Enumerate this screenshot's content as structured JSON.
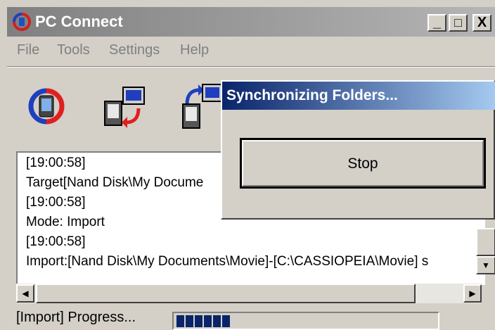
{
  "window": {
    "title": "PC Connect",
    "controls": {
      "minimize": "_",
      "maximize": "□",
      "close": "X"
    }
  },
  "menu": [
    "File",
    "Tools",
    "Settings",
    "Help"
  ],
  "toolbar": {
    "buttons": [
      {
        "name": "sync-icon"
      },
      {
        "name": "transfer-to-pc-icon"
      },
      {
        "name": "transfer-to-device-icon"
      }
    ]
  },
  "log": {
    "lines": [
      "[19:00:58]",
      "Target[Nand Disk\\My Docume",
      "[19:00:58]",
      "Mode: Import",
      "[19:00:58]",
      "Import:[Nand Disk\\My Documents\\Movie]-[C:\\CASSIOPEIA\\Movie] s"
    ]
  },
  "status": {
    "label": "[Import] Progress...",
    "progress_segments_filled": 6
  },
  "dialog": {
    "title": "Synchronizing Folders...",
    "stop_label": "Stop"
  },
  "colors": {
    "dialog_title_start": "#0a246a",
    "dialog_title_end": "#a6caf0",
    "progress_fill": "#0a246a",
    "face": "#d4d0c8"
  }
}
